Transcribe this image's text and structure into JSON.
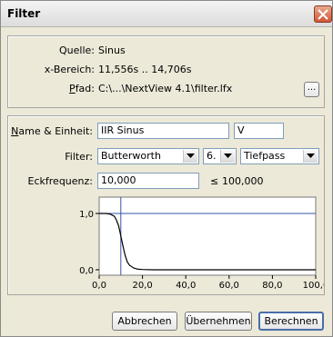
{
  "window": {
    "title": "Filter"
  },
  "source": {
    "quelle_label": "Quelle:",
    "quelle_value": "Sinus",
    "bereich_label": "x-Bereich:",
    "bereich_value": "11,556s .. 14,706s",
    "pfad_label_underlined": "P",
    "pfad_label_rest": "fad:",
    "pfad_value": "C:\\...\\NextView 4.1\\filter.lfx",
    "browse_label": "..."
  },
  "form": {
    "name_label_underlined": "N",
    "name_label_rest": "ame & Einheit:",
    "name_value": "IIR Sinus",
    "unit_value": "V",
    "filter_label": "Filter:",
    "filter_type": "Butterworth",
    "filter_order": "6.",
    "filter_mode": "Tiefpass",
    "freq_label": "Eckfrequenz:",
    "freq_value": "10,000",
    "limit_symbol": "≤",
    "limit_value": "100,000"
  },
  "chart_data": {
    "type": "line",
    "y_tick_labels": [
      "1,0",
      "0,0"
    ],
    "x_tick_labels": [
      "0,0",
      "20,0",
      "40,0",
      "60,0",
      "80,0",
      "100,0"
    ],
    "xlim": [
      0,
      100
    ],
    "ylim": [
      0,
      1
    ],
    "cutoff_marker_x": 10,
    "reference_line_y": 1.0,
    "series": [
      {
        "color": "#000000",
        "x": [
          0,
          3,
          5,
          7,
          8,
          9,
          10,
          11,
          12,
          13,
          14,
          16,
          18,
          20,
          25,
          100
        ],
        "values": [
          1.0,
          1.0,
          0.99,
          0.95,
          0.88,
          0.78,
          0.6,
          0.42,
          0.25,
          0.14,
          0.08,
          0.03,
          0.01,
          0.005,
          0,
          0
        ]
      }
    ],
    "colors": {
      "reference": "#3355aa",
      "marker": "#3355aa"
    }
  },
  "buttons": {
    "cancel": "Abbrechen",
    "apply": "Übernehmen",
    "compute": "Berechnen"
  }
}
